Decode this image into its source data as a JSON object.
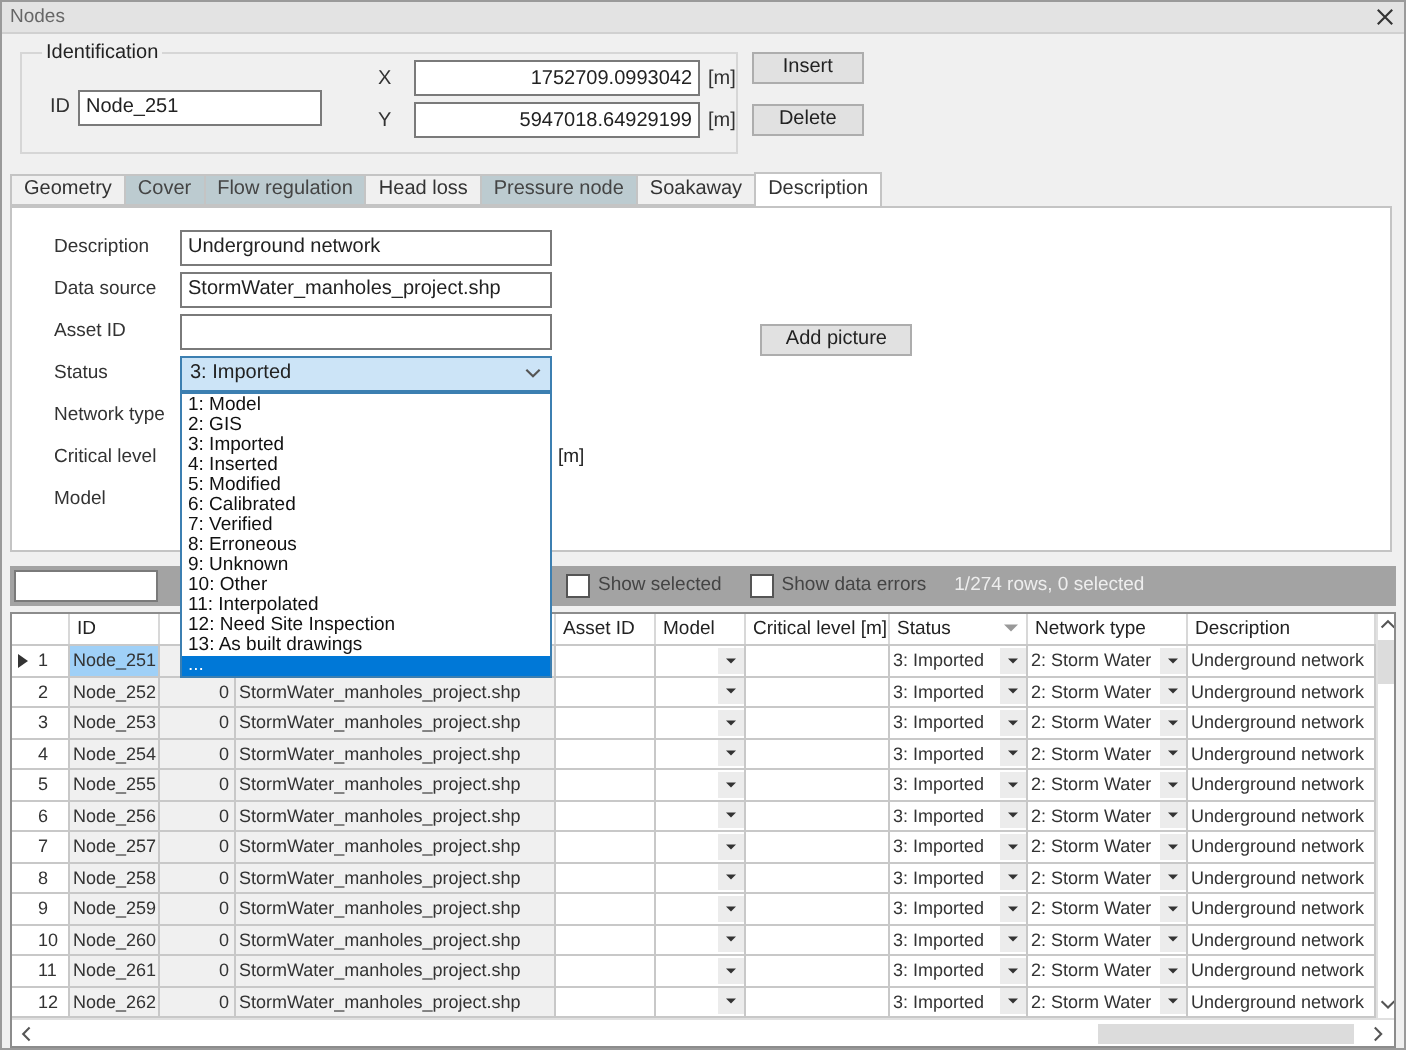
{
  "window": {
    "title": "Nodes"
  },
  "identification": {
    "legend": "Identification",
    "id_label": "ID",
    "id_value": "Node_251",
    "x_label": "X",
    "x_value": "1752709.0993042",
    "x_unit": "[m]",
    "y_label": "Y",
    "y_value": "5947018.64929199",
    "y_unit": "[m]"
  },
  "buttons": [
    "Insert",
    "Delete"
  ],
  "tabs": [
    {
      "label": "Geometry",
      "selected": false,
      "disabled": false
    },
    {
      "label": "Cover",
      "selected": false,
      "disabled": true
    },
    {
      "label": "Flow regulation",
      "selected": false,
      "disabled": true
    },
    {
      "label": "Head loss",
      "selected": false,
      "disabled": false
    },
    {
      "label": "Pressure node",
      "selected": false,
      "disabled": true
    },
    {
      "label": "Soakaway",
      "selected": false,
      "disabled": false
    },
    {
      "label": "Description",
      "selected": true,
      "disabled": false
    }
  ],
  "form": {
    "fields": [
      {
        "kind": "text",
        "label": "Description",
        "value": "Underground network"
      },
      {
        "kind": "text",
        "label": "Data source",
        "value": "StormWater_manholes_project.shp"
      },
      {
        "kind": "text",
        "label": "Asset ID"
      },
      {
        "kind": "combo",
        "label": "Status",
        "value": "3: Imported",
        "expanded": true
      },
      {
        "kind": "covered",
        "label": "Network type"
      },
      {
        "kind": "covered",
        "label": "Critical level",
        "unit": "[m]"
      },
      {
        "kind": "covered",
        "label": "Model"
      }
    ],
    "add_picture": "Add picture",
    "status_options": [
      {
        "label": "1: Model",
        "selected": false
      },
      {
        "label": "2: GIS",
        "selected": false
      },
      {
        "label": "3: Imported",
        "selected": false
      },
      {
        "label": "4: Inserted",
        "selected": false
      },
      {
        "label": "5: Modified",
        "selected": false
      },
      {
        "label": "6: Calibrated",
        "selected": false
      },
      {
        "label": "7: Verified",
        "selected": false
      },
      {
        "label": "8: Erroneous",
        "selected": false
      },
      {
        "label": "9: Unknown",
        "selected": false
      },
      {
        "label": "10: Other",
        "selected": false
      },
      {
        "label": "11: Interpolated",
        "selected": false
      },
      {
        "label": "12: Need Site Inspection",
        "selected": false
      },
      {
        "label": "13: As built drawings",
        "selected": false
      },
      {
        "label": "...",
        "selected": true
      }
    ]
  },
  "toolbar": {
    "show_selected": {
      "label": "Show selected",
      "checked": false
    },
    "show_data_errors": {
      "label": "Show data errors",
      "checked": false
    },
    "row_count": "1/274 rows, 0 selected"
  },
  "table": {
    "columns": [
      {
        "label": "ID",
        "kind": "text",
        "readonly": true
      },
      {
        "kind": "number",
        "readonly": true
      },
      {
        "kind": "text",
        "readonly": true
      },
      {
        "label": "Asset ID",
        "kind": "text",
        "readonly": false
      },
      {
        "label": "Model",
        "kind": "combo",
        "readonly": false
      },
      {
        "label": "Critical level [m]",
        "kind": "text",
        "readonly": false
      },
      {
        "label": "Status",
        "kind": "combo",
        "readonly": false,
        "sorted": true
      },
      {
        "label": "Network type",
        "kind": "combo",
        "readonly": false
      },
      {
        "label": "Description",
        "kind": "text",
        "readonly": false
      }
    ],
    "rows": [
      {
        "number": "1",
        "selected": true,
        "cells": [
          "Node_251",
          null,
          null,
          null,
          null,
          null,
          "3: Imported",
          "2: Storm Water",
          "Underground network"
        ]
      },
      {
        "number": "2",
        "selected": false,
        "cells": [
          "Node_252",
          "0",
          "StormWater_manholes_project.shp",
          null,
          null,
          null,
          "3: Imported",
          "2: Storm Water",
          "Underground network"
        ]
      },
      {
        "number": "3",
        "selected": false,
        "cells": [
          "Node_253",
          "0",
          "StormWater_manholes_project.shp",
          null,
          null,
          null,
          "3: Imported",
          "2: Storm Water",
          "Underground network"
        ]
      },
      {
        "number": "4",
        "selected": false,
        "cells": [
          "Node_254",
          "0",
          "StormWater_manholes_project.shp",
          null,
          null,
          null,
          "3: Imported",
          "2: Storm Water",
          "Underground network"
        ]
      },
      {
        "number": "5",
        "selected": false,
        "cells": [
          "Node_255",
          "0",
          "StormWater_manholes_project.shp",
          null,
          null,
          null,
          "3: Imported",
          "2: Storm Water",
          "Underground network"
        ]
      },
      {
        "number": "6",
        "selected": false,
        "cells": [
          "Node_256",
          "0",
          "StormWater_manholes_project.shp",
          null,
          null,
          null,
          "3: Imported",
          "2: Storm Water",
          "Underground network"
        ]
      },
      {
        "number": "7",
        "selected": false,
        "cells": [
          "Node_257",
          "0",
          "StormWater_manholes_project.shp",
          null,
          null,
          null,
          "3: Imported",
          "2: Storm Water",
          "Underground network"
        ]
      },
      {
        "number": "8",
        "selected": false,
        "cells": [
          "Node_258",
          "0",
          "StormWater_manholes_project.shp",
          null,
          null,
          null,
          "3: Imported",
          "2: Storm Water",
          "Underground network"
        ]
      },
      {
        "number": "9",
        "selected": false,
        "cells": [
          "Node_259",
          "0",
          "StormWater_manholes_project.shp",
          null,
          null,
          null,
          "3: Imported",
          "2: Storm Water",
          "Underground network"
        ]
      },
      {
        "number": "10",
        "selected": false,
        "cells": [
          "Node_260",
          "0",
          "StormWater_manholes_project.shp",
          null,
          null,
          null,
          "3: Imported",
          "2: Storm Water",
          "Underground network"
        ]
      },
      {
        "number": "11",
        "selected": false,
        "cells": [
          "Node_261",
          "0",
          "StormWater_manholes_project.shp",
          null,
          null,
          null,
          "3: Imported",
          "2: Storm Water",
          "Underground network"
        ]
      },
      {
        "number": "12",
        "selected": false,
        "cells": [
          "Node_262",
          "0",
          "StormWater_manholes_project.shp",
          null,
          null,
          null,
          "3: Imported",
          "2: Storm Water",
          "Underground network"
        ]
      }
    ]
  }
}
